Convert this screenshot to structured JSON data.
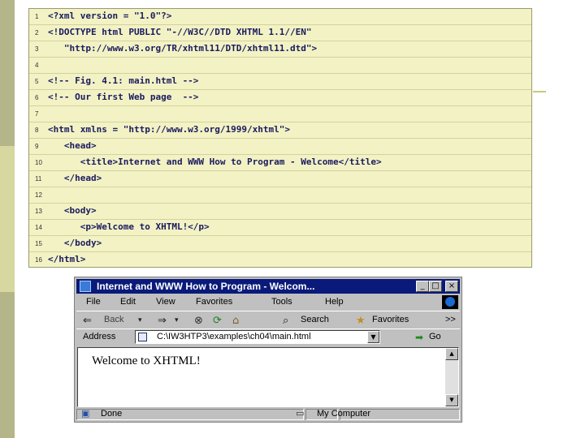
{
  "code_listing": {
    "lines": [
      {
        "number": "1",
        "code": "<?xml version = \"1.0\"?>"
      },
      {
        "number": "2",
        "code": "<!DOCTYPE html PUBLIC \"-//W3C//DTD XHTML 1.1//EN\""
      },
      {
        "number": "3",
        "code": "   \"http://www.w3.org/TR/xhtml11/DTD/xhtml11.dtd\">"
      },
      {
        "number": "4",
        "code": ""
      },
      {
        "number": "5",
        "code": "<!-- Fig. 4.1: main.html -->"
      },
      {
        "number": "6",
        "code": "<!-- Our first Web page  -->"
      },
      {
        "number": "7",
        "code": ""
      },
      {
        "number": "8",
        "code": "<html xmlns = \"http://www.w3.org/1999/xhtml\">"
      },
      {
        "number": "9",
        "code": "   <head>"
      },
      {
        "number": "10",
        "code": "      <title>Internet and WWW How to Program - Welcome</title>"
      },
      {
        "number": "11",
        "code": "   </head>"
      },
      {
        "number": "12",
        "code": ""
      },
      {
        "number": "13",
        "code": "   <body>"
      },
      {
        "number": "14",
        "code": "      <p>Welcome to XHTML!</p>"
      },
      {
        "number": "15",
        "code": "   </body>"
      },
      {
        "number": "16",
        "code": "</html>"
      }
    ]
  },
  "browser": {
    "title": "Internet and WWW How to Program - Welcom...",
    "window_buttons": {
      "minimize": "_",
      "maximize": "□",
      "close": "×"
    },
    "menu": [
      "File",
      "Edit",
      "View",
      "Favorites",
      "Tools",
      "Help"
    ],
    "toolbar": {
      "back": "Back",
      "search": "Search",
      "favorites": "Favorites",
      "more": ">>"
    },
    "address": {
      "label": "Address",
      "value": "C:\\IW3HTP3\\examples\\ch04\\main.html",
      "go": "Go"
    },
    "page_content": "Welcome to XHTML!",
    "status": {
      "left": "Done",
      "right": "My Computer"
    },
    "icons": [
      "ie-logo-icon",
      "back-icon",
      "forward-icon",
      "stop-icon",
      "refresh-icon",
      "home-icon",
      "search-icon",
      "favorites-icon",
      "page-icon",
      "go-icon",
      "computer-icon"
    ]
  },
  "colors": {
    "code_background": "#f2f2c4",
    "sidebar": "#d7d7a0",
    "titlebar": "#0a1a7a"
  }
}
